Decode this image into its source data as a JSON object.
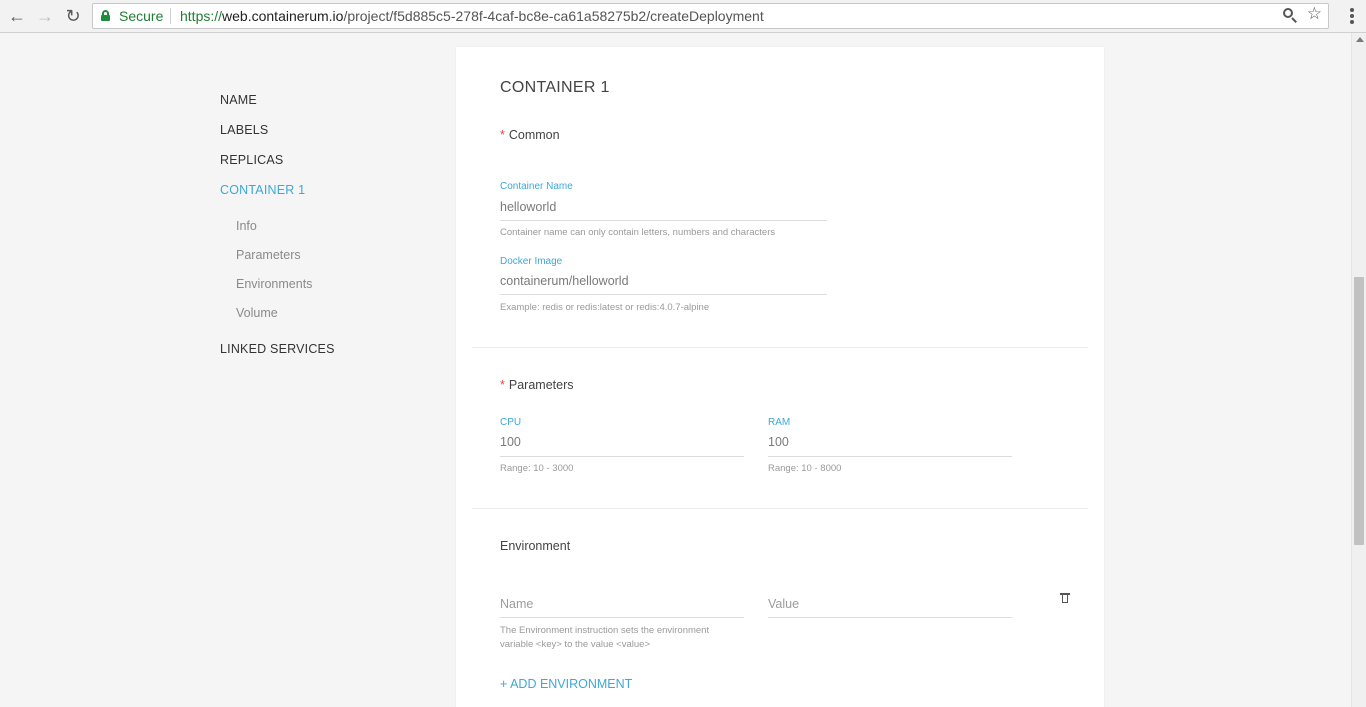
{
  "browser": {
    "secure_label": "Secure",
    "url_scheme": "https://",
    "url_host": "web.containerum.io",
    "url_path": "/project/f5d885c5-278f-4caf-bc8e-ca61a58275b2/createDeployment",
    "back_icon": "arrow-left-icon",
    "forward_icon": "arrow-right-icon",
    "reload_icon": "reload-icon",
    "zoom_icon": "magnifier-icon",
    "bookmark_icon": "star-icon",
    "menu_icon": "kebab-menu-icon"
  },
  "sidebar": {
    "items": [
      {
        "label": "NAME"
      },
      {
        "label": "LABELS"
      },
      {
        "label": "REPLICAS"
      },
      {
        "label": "CONTAINER 1",
        "active": true
      },
      {
        "label": "LINKED SERVICES"
      }
    ],
    "subitems": [
      {
        "label": "Info"
      },
      {
        "label": "Parameters"
      },
      {
        "label": "Environments"
      },
      {
        "label": "Volume"
      }
    ]
  },
  "container": {
    "title": "CONTAINER 1",
    "common": {
      "title": "Common",
      "required_mark": "*",
      "name_label": "Container Name",
      "name_value": "helloworld",
      "name_hint": "Container name can only contain letters, numbers and characters",
      "image_label": "Docker Image",
      "image_value": "containerum/helloworld",
      "image_hint": "Example: redis or redis:latest or redis:4.0.7-alpine"
    },
    "parameters": {
      "title": "Parameters",
      "required_mark": "*",
      "cpu_label": "CPU",
      "cpu_value": "100",
      "cpu_hint": "Range: 10 - 3000",
      "ram_label": "RAM",
      "ram_value": "100",
      "ram_hint": "Range: 10 - 8000"
    },
    "environment": {
      "title": "Environment",
      "name_placeholder": "Name",
      "value_placeholder": "Value",
      "hint_line1": "The Environment instruction sets the environment",
      "hint_line2": "variable <key> to the value <value>",
      "delete_icon": "trash-icon",
      "add_label": "+ ADD ENVIRONMENT"
    }
  },
  "colors": {
    "accent": "#3ea8d6",
    "required": "#e04a3f",
    "secure": "#1e7e34"
  }
}
